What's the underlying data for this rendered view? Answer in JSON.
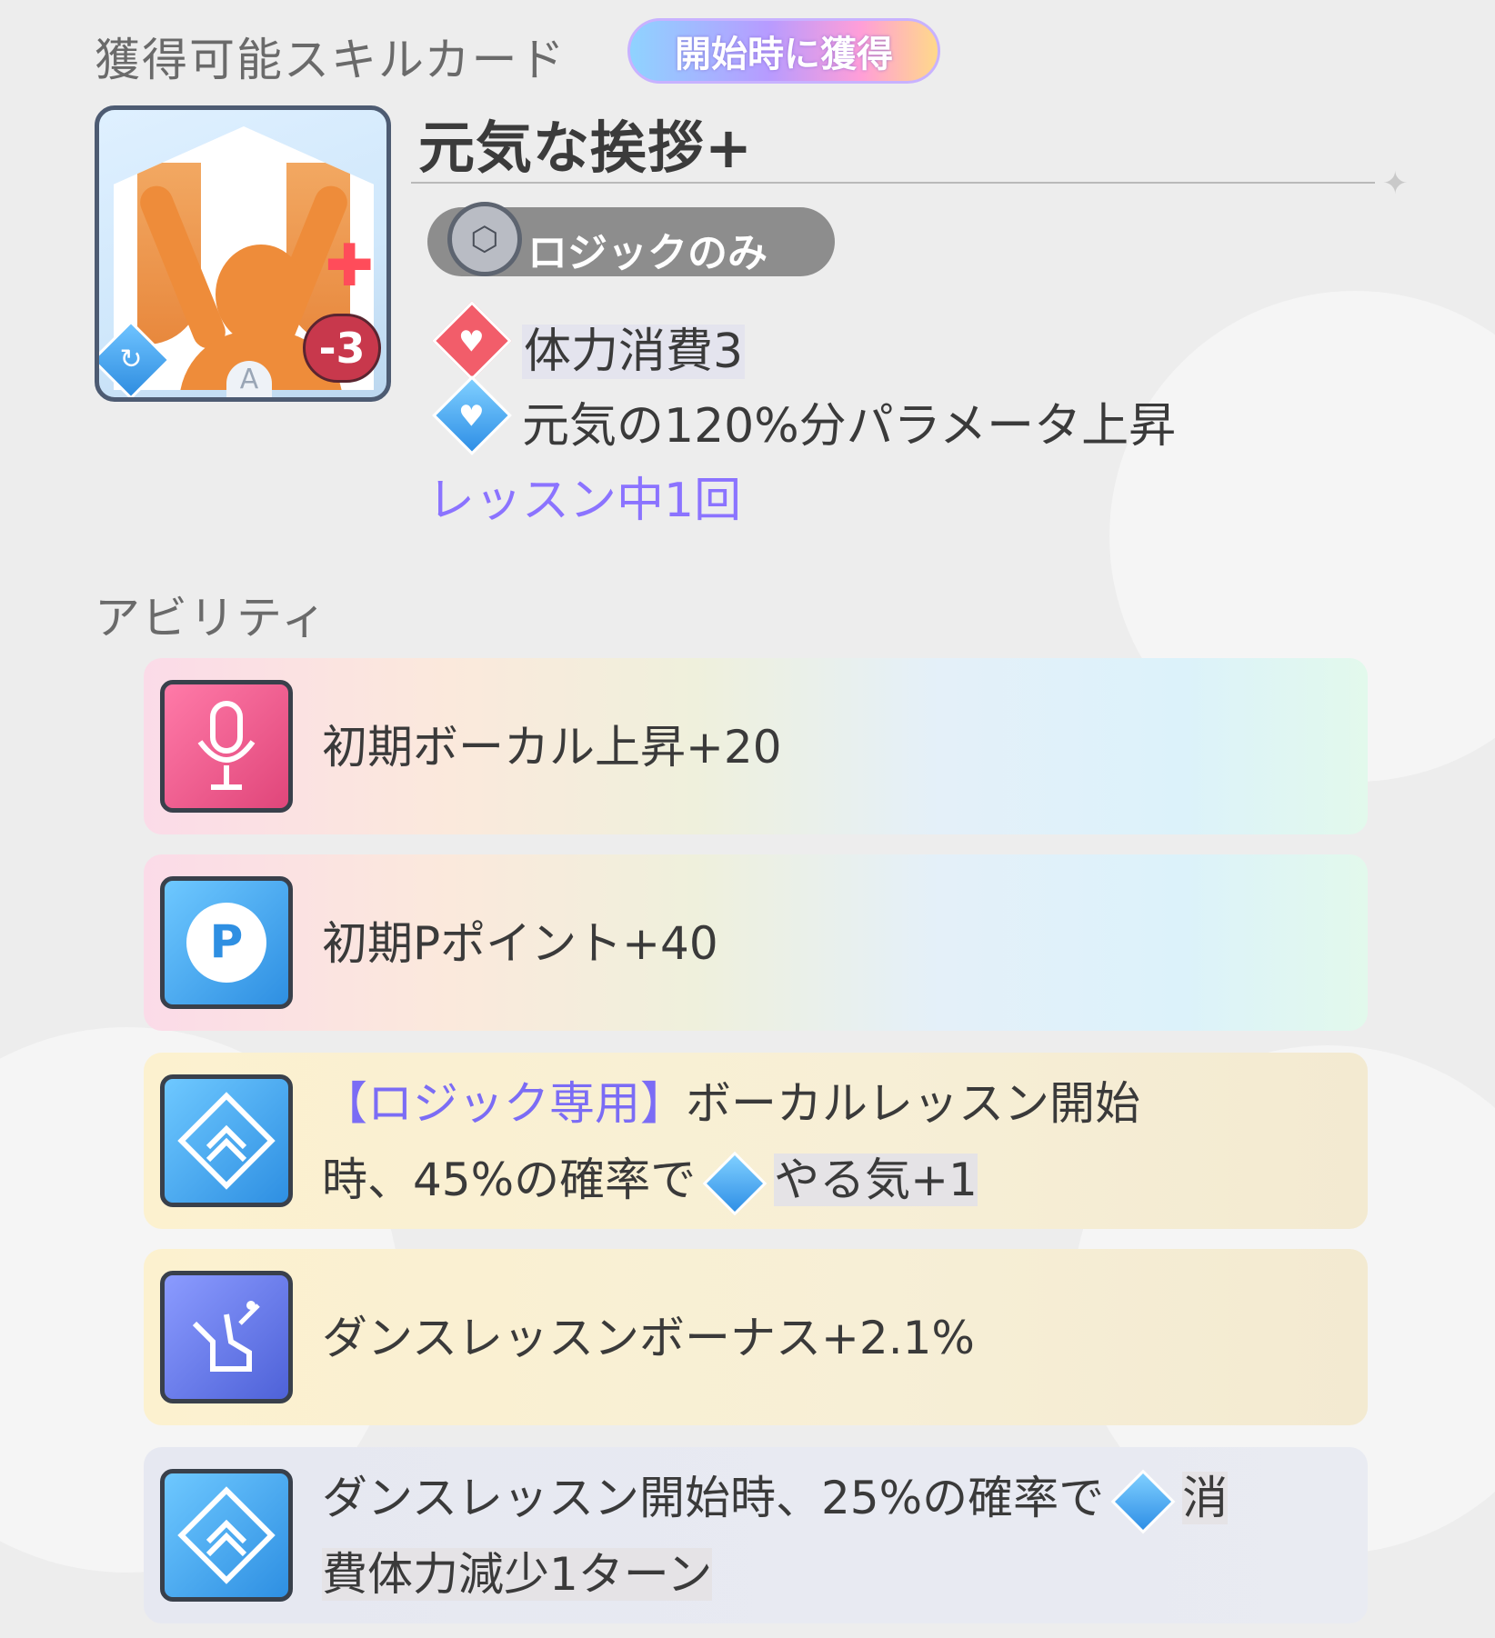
{
  "header": {
    "section_title": "獲得可能スキルカード",
    "start_badge": "開始時に獲得"
  },
  "card": {
    "name": "元気な挨拶+",
    "cost_value": "-3",
    "rank": "A",
    "plan_tag": "ロジックのみ",
    "effects": [
      {
        "icon": "heart-diamond-icon",
        "text": "体力消費3"
      },
      {
        "icon": "genki-diamond-icon",
        "text": "元気の120%分パラメータ上昇"
      }
    ],
    "limit": "レッスン中1回"
  },
  "abilities": {
    "section_title": "アビリティ",
    "items": [
      {
        "icon": "microphone-icon",
        "text": "初期ボーカル上昇+20"
      },
      {
        "icon": "p-point-icon",
        "text": "初期Pポイント+40"
      },
      {
        "icon": "chevron-up-diamond-icon",
        "tag": "【ロジック専用】",
        "text_a": "ボーカルレッスン開始",
        "text_b": "時、45%の確率で",
        "text_c": "やる気+1"
      },
      {
        "icon": "dance-shoe-icon",
        "text": "ダンスレッスンボーナス+2.1%"
      },
      {
        "icon": "chevron-up-diamond-icon",
        "text_a": "ダンスレッスン開始時、25%の確率で",
        "text_b": "消",
        "text_c": "費体力減少1ターン"
      }
    ]
  },
  "colors": {
    "accent_purple": "#7b6cf5",
    "cost_red": "#c8384c",
    "icon_blue": "#2f8fe6"
  }
}
